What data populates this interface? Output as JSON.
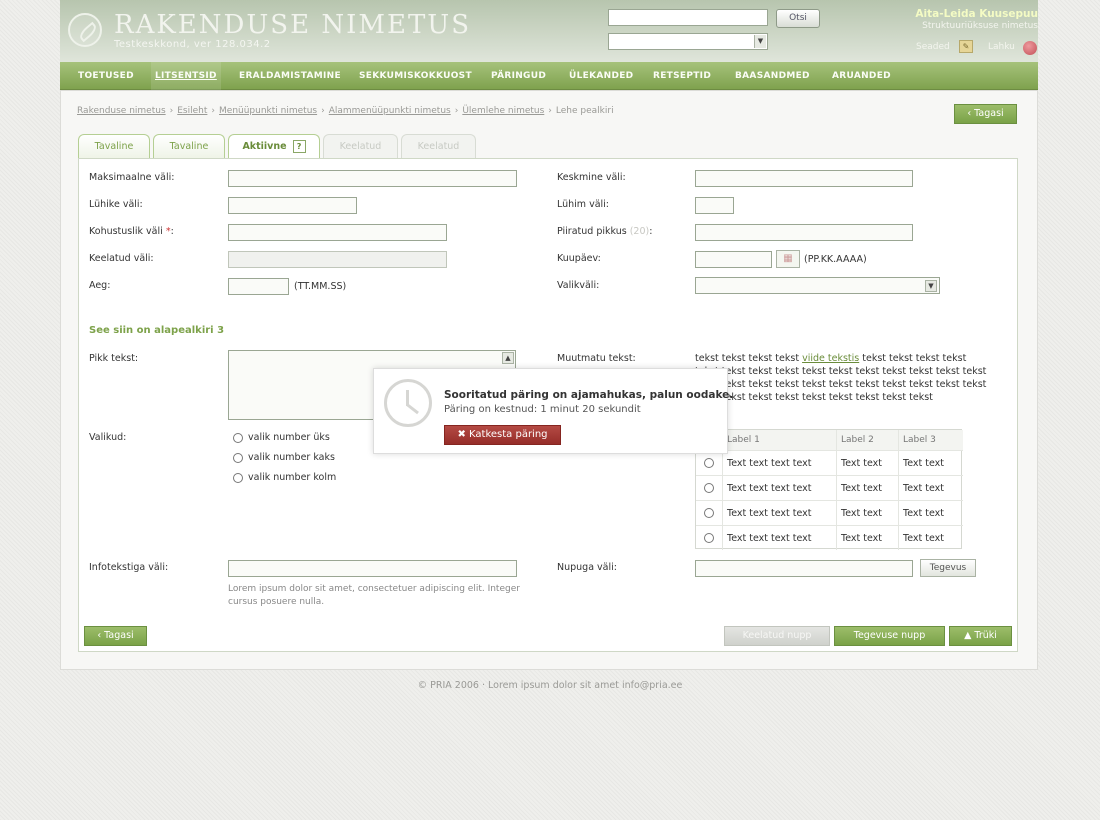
{
  "header": {
    "app_name": "RAKENDUSE NIMETUS",
    "app_version": "Testkeskkond, ver 128.034.2",
    "search_placeholder": "",
    "ok_label": "Otsi",
    "user_name": "Aita-Leida Kuusepuu",
    "user_unit": "Struktuuriüksuse nimetus",
    "settings_label": "Seaded",
    "exit_label": "Lahku"
  },
  "nav": [
    "TOETUSED",
    "LITSENTSID",
    "ERALDAMISTAMINE",
    "SEKKUMISKOKKUOST",
    "PÄRINGUD",
    "ÜLEKANDED",
    "RETSEPTID",
    "BAASANDMED",
    "ARUANDED"
  ],
  "breadcrumb": {
    "items": [
      "Rakenduse nimetus",
      "Esileht",
      "Menüüpunkti nimetus",
      "Alammenüüpunkti nimetus",
      "Ülemlehe nimetus"
    ],
    "current": "Lehe pealkiri",
    "sep": "›"
  },
  "back_label": "‹ Tagasi",
  "tabs": [
    {
      "label": "Tavaline"
    },
    {
      "label": "Tavaline"
    },
    {
      "label": "Aktiivne"
    },
    {
      "label": "Keelatud"
    },
    {
      "label": "Keelatud"
    }
  ],
  "tab_help": "?",
  "form": {
    "max_label": "Maksimaalne väli:",
    "medium_label": "Keskmine väli:",
    "short_label": "Lühike väli:",
    "shortest_label": "Lühim väli:",
    "required_label": "Kohustuslik väli",
    "required_mark": "*",
    "required_colon": ":",
    "limited_label": "Piiratud pikkus",
    "limited_count": "(20)",
    "limited_colon": ":",
    "disabled_label": "Keelatud väli:",
    "date_label": "Kuupäev:",
    "date_format": "(PP.KK.AAAA)",
    "cal_icon": "▦",
    "time_label": "Aeg:",
    "time_format": "(TT.MM.SS)",
    "select_label": "Valikväli:",
    "subheading": "See siin on alapealkiri 3",
    "long_text_label": "Pikk tekst:",
    "readonly_label": "Muutmatu tekst:",
    "readonly_text_1": "tekst tekst tekst tekst",
    "readonly_link": "viide tekstis",
    "readonly_text_2": "tekst tekst tekst tekst tekst tekst tekst tekst tekst tekst tekst tekst tekst tekst tekst tekst tekst tekst tekst tekst tekst tekst tekst tekst tekst tekst tekst tekst tekst tekst tekst tekst tekst tekst tekst",
    "choices_label": "Valikud:",
    "radio_options": [
      "valik number üks",
      "valik number kaks",
      "valik number kolm"
    ],
    "info_label": "Infotekstiga väli:",
    "info_help": "Lorem ipsum dolor sit amet, consectetuer adipiscing elit. Integer cursus posuere nulla.",
    "button_field_label": "Nupuga väli:",
    "button_field_button": "Tegevus"
  },
  "table": {
    "headers": [
      "Label 1",
      "Label 2",
      "Label 3"
    ],
    "rows": [
      [
        "Text text text text",
        "Text text",
        "Text text"
      ],
      [
        "Text text text text",
        "Text text",
        "Text text"
      ],
      [
        "Text text text text",
        "Text text",
        "Text text"
      ],
      [
        "Text text text text",
        "Text text",
        "Text text"
      ]
    ]
  },
  "actions": {
    "back": "‹ Tagasi",
    "disabled": "Keelatud nupp",
    "action": "Tegevuse nupp",
    "print": "▲ Trüki"
  },
  "footer": {
    "text": "© PRIA 2006 · Lorem ipsum dolor sit amet",
    "email": "info@pria.ee"
  },
  "modal": {
    "title": "Sooritatud päring on ajamahukas, palun oodake.",
    "duration": "Päring on kestnud: 1 minut 20 sekundit",
    "cancel": "✖ Katkesta päring"
  }
}
